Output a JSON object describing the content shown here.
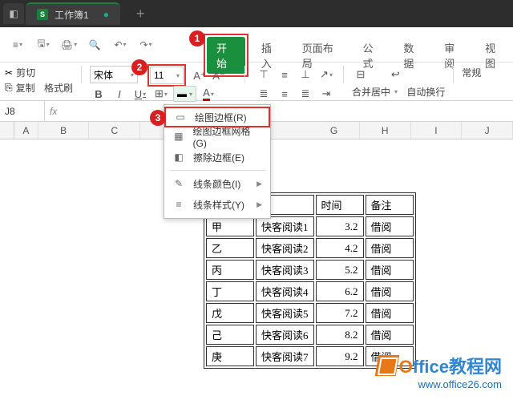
{
  "titlebar": {
    "workbook_name": "工作簿1",
    "app_initial": "S"
  },
  "ribbon": {
    "tabs": [
      "开始",
      "插入",
      "页面布局",
      "公式",
      "数据",
      "审阅",
      "视图"
    ],
    "active": "开始"
  },
  "toolbar2": {
    "cut": "剪切",
    "copy": "复制",
    "painter": "格式刷",
    "font_name": "宋体",
    "font_size": "11",
    "merge": "合并居中",
    "wrap": "自动换行",
    "normal": "常规"
  },
  "dropdown": {
    "items": [
      "绘图边框(R)",
      "绘图边框网格(G)",
      "擦除边框(E)",
      "线条颜色(I)",
      "线条样式(Y)"
    ]
  },
  "namebox": {
    "ref": "J8",
    "fx": "fx"
  },
  "columns": [
    "A",
    "B",
    "C",
    "G",
    "H",
    "I",
    "J"
  ],
  "callouts": {
    "c1": "1",
    "c2": "2",
    "c3": "3"
  },
  "chart_data": {
    "type": "table",
    "headers": [
      "",
      "",
      "时间",
      "备注"
    ],
    "rows": [
      [
        "甲",
        "快客阅读1",
        3.2,
        "借阅"
      ],
      [
        "乙",
        "快客阅读2",
        4.2,
        "借阅"
      ],
      [
        "丙",
        "快客阅读3",
        5.2,
        "借阅"
      ],
      [
        "丁",
        "快客阅读4",
        6.2,
        "借阅"
      ],
      [
        "戊",
        "快客阅读5",
        7.2,
        "借阅"
      ],
      [
        "己",
        "快客阅读6",
        8.2,
        "借阅"
      ],
      [
        "庚",
        "快客阅读7",
        9.2,
        "借阅"
      ]
    ]
  },
  "watermark": {
    "brand1": "O",
    "brand2": "ffice教程网",
    "url": "www.office26.com"
  }
}
